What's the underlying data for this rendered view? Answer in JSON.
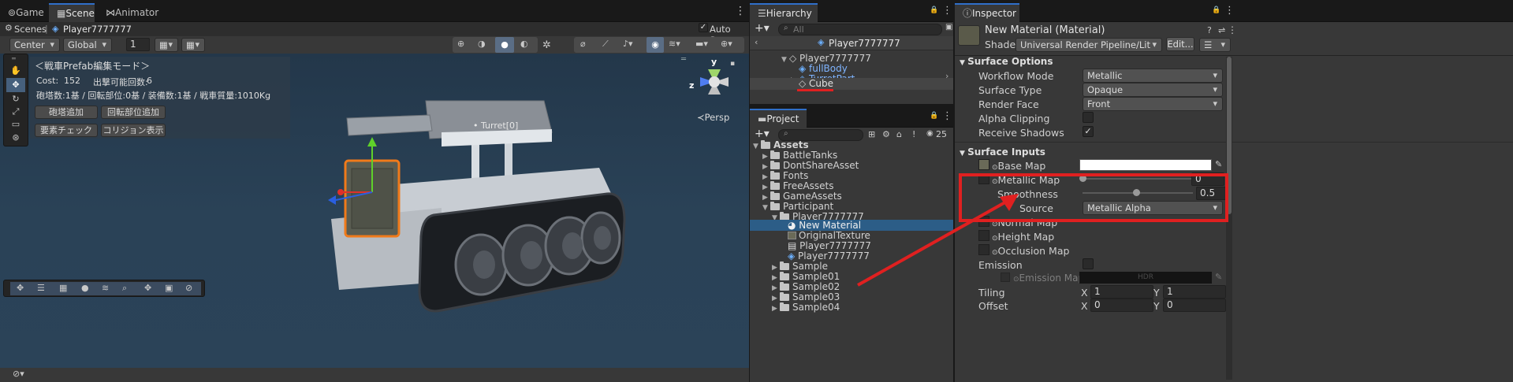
{
  "scene_tabs": {
    "game": "Game",
    "scene": "Scene",
    "animator": "Animator"
  },
  "breadcrumb": {
    "root": "Scenes",
    "current": "Player7777777",
    "auto_save": "Auto Save"
  },
  "scene_toolbar": {
    "pivot": "Center",
    "space": "Global",
    "grid_value": "1",
    "persp": "≺Persp",
    "gizmo_y": "y",
    "gizmo_z": "z"
  },
  "overlay": {
    "title": "＜戦車Prefab編集モード＞",
    "cost_label": "Cost:",
    "cost_value": "152",
    "sortie_label": "出撃可能回数:",
    "sortie_value": "6",
    "stats": "砲塔数:1基 / 回転部位:0基 / 装備数:1基 / 戦車質量:1010Kg",
    "btn_add_turret": "砲塔追加",
    "btn_add_rotator": "回転部位追加",
    "btn_check": "要素チェック",
    "btn_collision": "コリジョン表示"
  },
  "scene_labels": {
    "turret": "Turret[0]"
  },
  "hierarchy": {
    "tab": "Hierarchy",
    "search_placeholder": "All",
    "prefab_header": "Player7777777",
    "items": [
      {
        "label": "Player7777777",
        "color": "#d2d2d2"
      },
      {
        "label": "fullBody",
        "color": "#7fb4ff"
      },
      {
        "label": "TurretPart",
        "color": "#7fb4ff"
      },
      {
        "label": "Cube",
        "color": "#e0e0e0"
      }
    ]
  },
  "project": {
    "tab": "Project",
    "count": "25",
    "root": "Assets",
    "items": [
      "BattleTanks",
      "DontShareAsset",
      "Fonts",
      "FreeAssets",
      "GameAssets",
      "Participant",
      "Player7777777",
      "New Material",
      "OriginalTexture",
      "Player7777777",
      "Player7777777",
      "Sample",
      "Sample01",
      "Sample02",
      "Sample03",
      "Sample04"
    ]
  },
  "inspector": {
    "tab": "Inspector",
    "material_name": "New Material (Material)",
    "shader_label": "Shader",
    "shader_value": "Universal Render Pipeline/Lit",
    "edit_button": "Edit...",
    "surface_options": "Surface Options",
    "workflow_label": "Workflow Mode",
    "workflow_value": "Metallic",
    "surface_type_label": "Surface Type",
    "surface_type_value": "Opaque",
    "render_face_label": "Render Face",
    "render_face_value": "Front",
    "alpha_clip_label": "Alpha Clipping",
    "receive_shadows_label": "Receive Shadows",
    "surface_inputs": "Surface Inputs",
    "base_map_label": "Base Map",
    "metallic_map_label": "Metallic Map",
    "metallic_value": "0",
    "smoothness_label": "Smoothness",
    "smoothness_value": "0.5",
    "source_label": "Source",
    "source_value": "Metallic Alpha",
    "normal_map_label": "Normal Map",
    "height_map_label": "Height Map",
    "occlusion_map_label": "Occlusion Map",
    "emission_label": "Emission",
    "emission_map_label": "Emission Map",
    "hdr_label": "HDR",
    "tiling_label": "Tiling",
    "tiling_x": "1",
    "tiling_y": "1",
    "offset_label": "Offset",
    "offset_x": "0",
    "offset_y": "0",
    "x_label": "X",
    "y_label": "Y"
  },
  "colors": {
    "accent": "#2f6fc9",
    "annotation": "#e02020",
    "selection": "#2c5d87",
    "scene_bg": "#2c4458"
  }
}
